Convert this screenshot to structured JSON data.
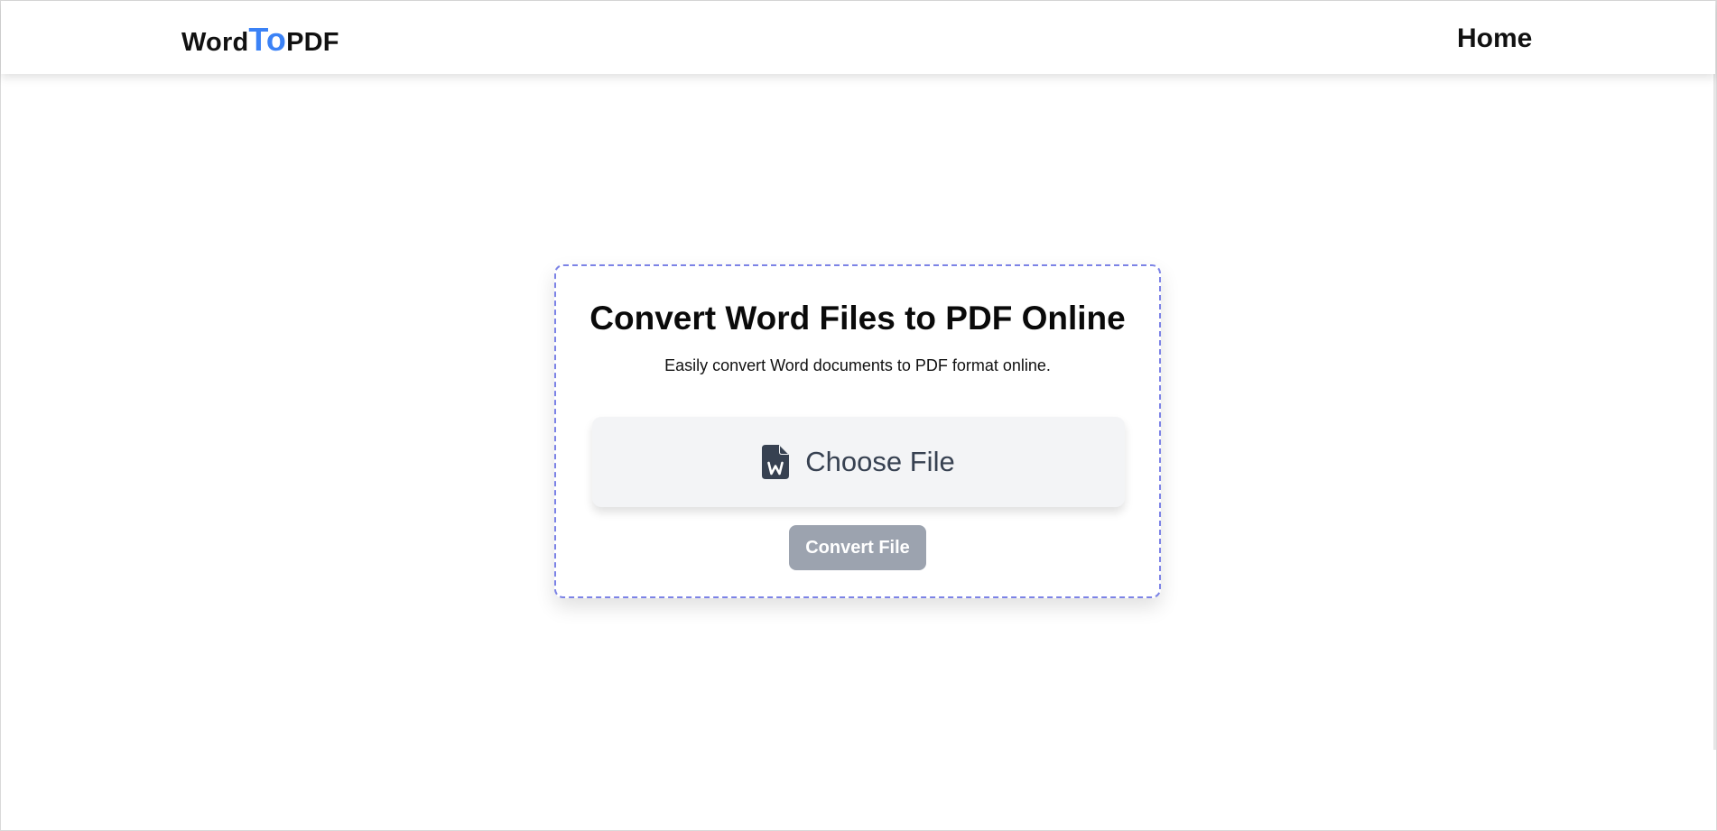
{
  "header": {
    "logo": {
      "part1": "Word",
      "part2": "To",
      "part3": "PDF"
    },
    "nav": {
      "home_label": "Home"
    }
  },
  "main": {
    "title": "Convert Word Files to PDF Online",
    "subtitle": "Easily convert Word documents to PDF format online.",
    "choose_file": {
      "label": "Choose File",
      "icon": "word-file-icon"
    },
    "convert_button": {
      "label": "Convert File",
      "state": "disabled"
    }
  },
  "colors": {
    "accent": "#3b82f6",
    "card_border": "#7c83e6",
    "button_disabled": "#9ca3af",
    "choose_bg": "#f3f4f6",
    "icon": "#374151"
  }
}
